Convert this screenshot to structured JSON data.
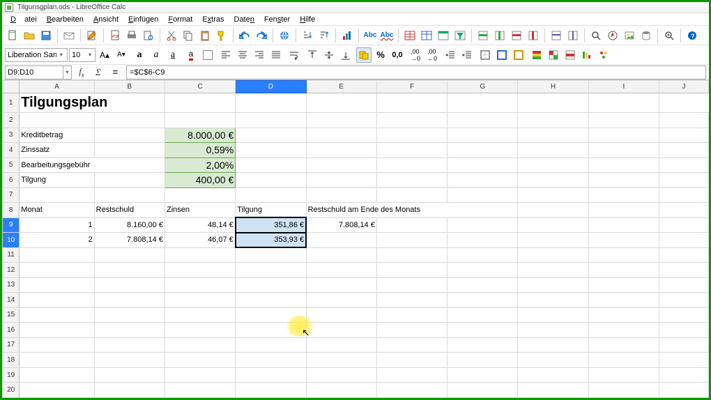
{
  "window": {
    "title": "Tilgunsgplan.ods - LibreOffice Calc"
  },
  "menu": {
    "items": [
      "Datei",
      "Bearbeiten",
      "Ansicht",
      "Einfügen",
      "Format",
      "Extras",
      "Daten",
      "Fenster",
      "Hilfe"
    ]
  },
  "format": {
    "font_name": "Liberation Sans",
    "font_size": "10"
  },
  "formula_bar": {
    "cell_ref": "D9:D10",
    "formula": "=$C$6-C9"
  },
  "columns": [
    "A",
    "B",
    "C",
    "D",
    "E",
    "F",
    "G",
    "H",
    "I",
    "J"
  ],
  "rows": {
    "r1": {
      "A": "Tilgungsplan"
    },
    "r3": {
      "A": "Kreditbetrag",
      "C": "8.000,00 €"
    },
    "r4": {
      "A": "Zinssatz",
      "C": "0,59%"
    },
    "r5": {
      "A": "Bearbeitungsgebühr",
      "C": "2,00%"
    },
    "r6": {
      "A": "Tilgung",
      "C": "400,00 €"
    },
    "r8": {
      "A": "Monat",
      "B": "Restschuld",
      "C": "Zinsen",
      "D": "Tilgung",
      "E": "Restschuld am Ende des Monats"
    },
    "r9": {
      "A": "1",
      "B": "8.160,00 €",
      "C": "48,14 €",
      "D": "351,86 €",
      "E": "7.808,14 €"
    },
    "r10": {
      "A": "2",
      "B": "7.808,14 €",
      "C": "46,07 €",
      "D": "353,93 €"
    }
  },
  "icons": {
    "new": "new-icon",
    "open": "open-icon",
    "save": "save-icon",
    "pdf": "pdf-icon",
    "print": "print-icon",
    "preview": "preview-icon",
    "cut": "cut-icon",
    "copy": "copy-icon",
    "paste": "paste-icon",
    "brush": "brush-icon",
    "undo": "undo-icon",
    "redo": "redo-icon",
    "link": "link-icon",
    "sort-asc": "sort-asc-icon",
    "sort-desc": "sort-desc-icon",
    "chart": "chart-icon",
    "spell": "spell-icon",
    "filter": "filter-icon",
    "grid": "grid-icon"
  }
}
